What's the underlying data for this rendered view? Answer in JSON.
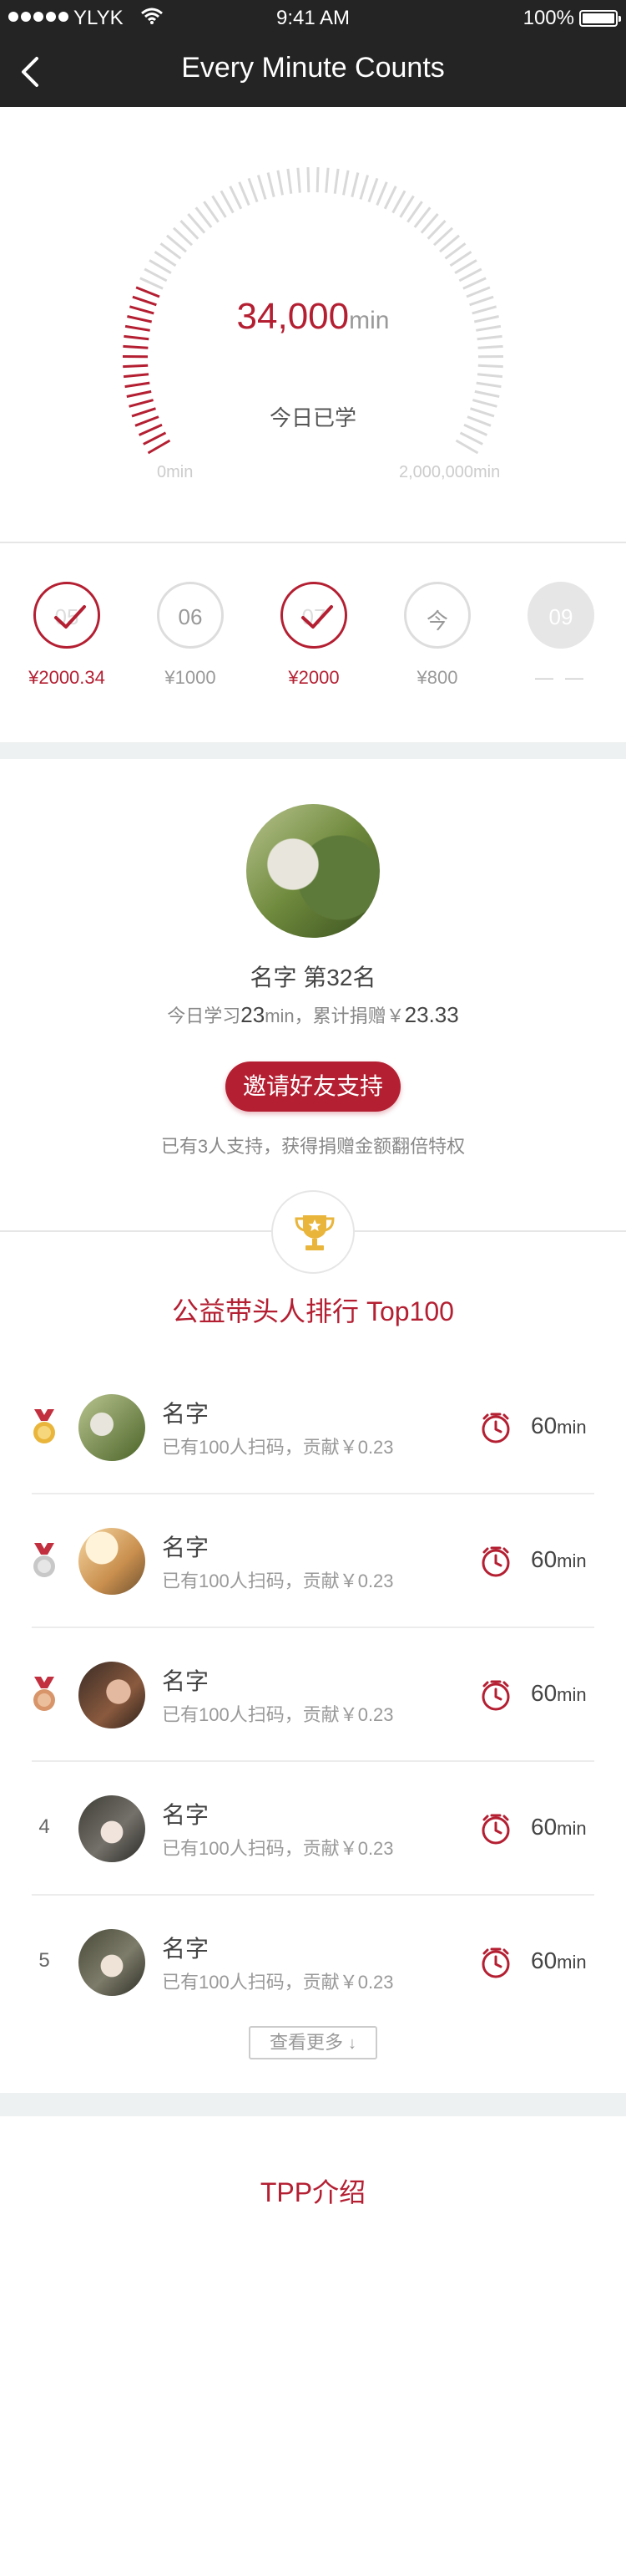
{
  "status_bar": {
    "carrier": "YLYK",
    "time": "9:41 AM",
    "battery": "100%"
  },
  "nav": {
    "back_icon": "chevron-left-icon",
    "title": "Every Minute Counts"
  },
  "gauge": {
    "value": "34,000",
    "unit": "min",
    "label": "今日已学",
    "min_label": "0min",
    "max_label": "2,000,000min",
    "progress": 0.22,
    "active_color": "#b41f32",
    "inactive_color": "#d9d9d9"
  },
  "days": [
    {
      "number": "05",
      "amount": "¥2000.34",
      "state": "checked"
    },
    {
      "number": "06",
      "amount": "¥1000",
      "state": "unchecked"
    },
    {
      "number": "07",
      "amount": "¥2000",
      "state": "checked"
    },
    {
      "number": "今",
      "amount": "¥800",
      "state": "unchecked"
    },
    {
      "number": "09",
      "amount": "— —",
      "state": "future"
    }
  ],
  "profile": {
    "name_rank": "名字  第32名",
    "stats_prefix": "今日学习",
    "stats_minutes": "23",
    "stats_middle": "min，累计捐赠￥",
    "stats_donated": "23.33",
    "invite_label": "邀请好友支持",
    "note": "已有3人支持，获得捐赠金额翻倍特权"
  },
  "ranking": {
    "title": "公益带头人排行 Top100",
    "trophy_icon": "trophy-icon",
    "rows": [
      {
        "rank": "1",
        "medal": "gold",
        "name": "名字",
        "desc": "已有100人扫码，贡献￥0.23",
        "minutes": "60",
        "unit": "min"
      },
      {
        "rank": "2",
        "medal": "silver",
        "name": "名字",
        "desc": "已有100人扫码，贡献￥0.23",
        "minutes": "60",
        "unit": "min"
      },
      {
        "rank": "3",
        "medal": "bronze",
        "name": "名字",
        "desc": "已有100人扫码，贡献￥0.23",
        "minutes": "60",
        "unit": "min"
      },
      {
        "rank": "4",
        "medal": "",
        "name": "名字",
        "desc": "已有100人扫码，贡献￥0.23",
        "minutes": "60",
        "unit": "min"
      },
      {
        "rank": "5",
        "medal": "",
        "name": "名字",
        "desc": "已有100人扫码，贡献￥0.23",
        "minutes": "60",
        "unit": "min"
      }
    ],
    "more_label": "查看更多",
    "more_icon": "arrow-down-icon"
  },
  "tpp": {
    "title": "TPP介绍"
  },
  "colors": {
    "accent": "#b41f32",
    "gold": "#e9b53b",
    "silver": "#c8c8c8",
    "bronze": "#d8956a",
    "ribbon": "#c2303f"
  }
}
